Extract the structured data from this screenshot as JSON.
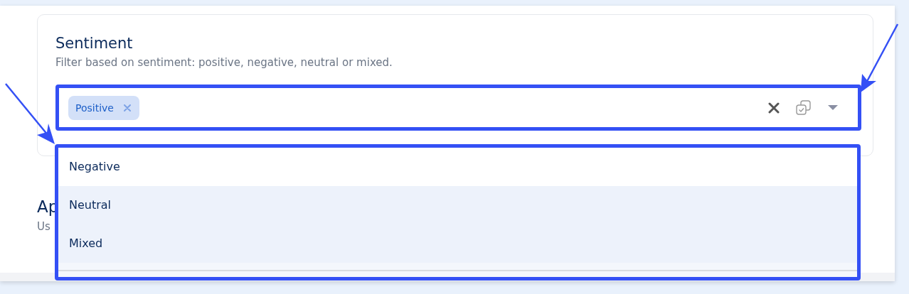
{
  "section": {
    "title": "Sentiment",
    "description": "Filter based on sentiment: positive, negative, neutral or mixed."
  },
  "select": {
    "tags": [
      {
        "label": "Positive"
      }
    ]
  },
  "options": [
    {
      "label": "Negative",
      "highlighted": false
    },
    {
      "label": "Neutral",
      "highlighted": true
    },
    {
      "label": "Mixed",
      "highlighted": true
    }
  ],
  "next_section": {
    "title": "Ap",
    "description": "Us"
  }
}
